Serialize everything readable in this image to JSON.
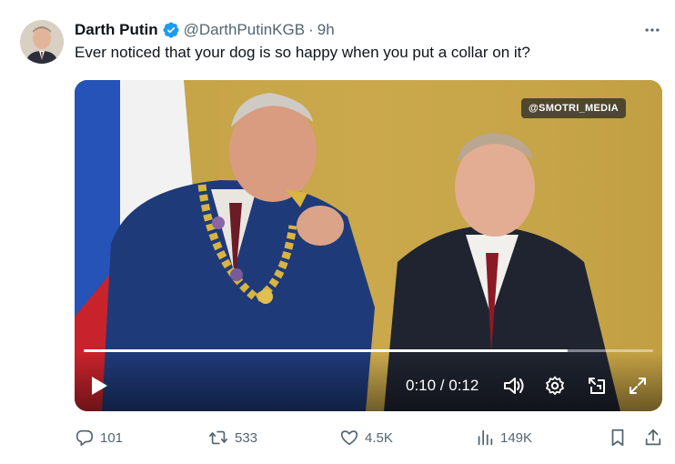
{
  "author": {
    "display_name": "Darth Putin",
    "handle": "@DarthPutinKGB",
    "separator": "·",
    "time": "9h",
    "verified": true
  },
  "tweet": {
    "text": "Ever noticed that your dog is so happy when you put a collar on it?"
  },
  "video": {
    "watermark": "@SMOTRI_MEDIA",
    "time_readout": "0:10 / 0:12",
    "progress": 0.85
  },
  "actions": {
    "replies": "101",
    "retweets": "533",
    "likes": "4.5K",
    "views": "149K"
  },
  "colors": {
    "text_primary": "#0f1419",
    "text_secondary": "#536471",
    "verified_blue": "#1d9bf0",
    "background_gold": "#c9a84a"
  },
  "icons": {
    "verified": "verified-badge-icon",
    "more": "more-horizontal-icon",
    "play": "play-icon",
    "volume": "volume-icon",
    "settings": "gear-icon",
    "pip": "picture-in-picture-icon",
    "fullscreen": "fullscreen-icon",
    "reply": "reply-icon",
    "retweet": "retweet-icon",
    "like": "heart-icon",
    "views": "views-chart-icon",
    "bookmark": "bookmark-icon",
    "share": "share-icon"
  }
}
